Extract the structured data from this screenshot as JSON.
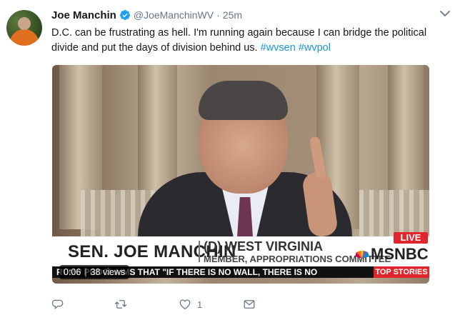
{
  "tweet": {
    "display_name": "Joe Manchin",
    "handle": "@JoeManchinWV",
    "separator": "·",
    "time": "25m",
    "text_plain": "D.C. can be frustrating as hell. I'm running again because I can bridge the political divide and put the days of division behind us. ",
    "hashtags": [
      "#wvsen",
      "#wvpol"
    ],
    "verified": true
  },
  "video": {
    "lower_third_name": "SEN. JOE MANCHIN",
    "lower_third_state": "(D) WEST VIRGINIA",
    "lower_third_role": "MEMBER, APPROPRIATIONS COMMITTEE",
    "live_label": "LIVE",
    "network": "MSNBC",
    "ticker": "RUMP PROCLAIMS THAT \"IF THERE IS NO WALL, THERE IS NO",
    "ticker_tag": "TOP STORIES",
    "duration": "0:06",
    "views": "38 views"
  },
  "actions": {
    "reply_count": "",
    "retweet_count": "",
    "like_count": "1",
    "message_count": ""
  },
  "colors": {
    "link": "#1b95e0",
    "muted": "#657786",
    "accent_red": "#e0262c"
  },
  "icons": [
    "verified-badge-icon",
    "chevron-down-icon",
    "reply-icon",
    "retweet-icon",
    "like-icon",
    "direct-message-icon"
  ]
}
